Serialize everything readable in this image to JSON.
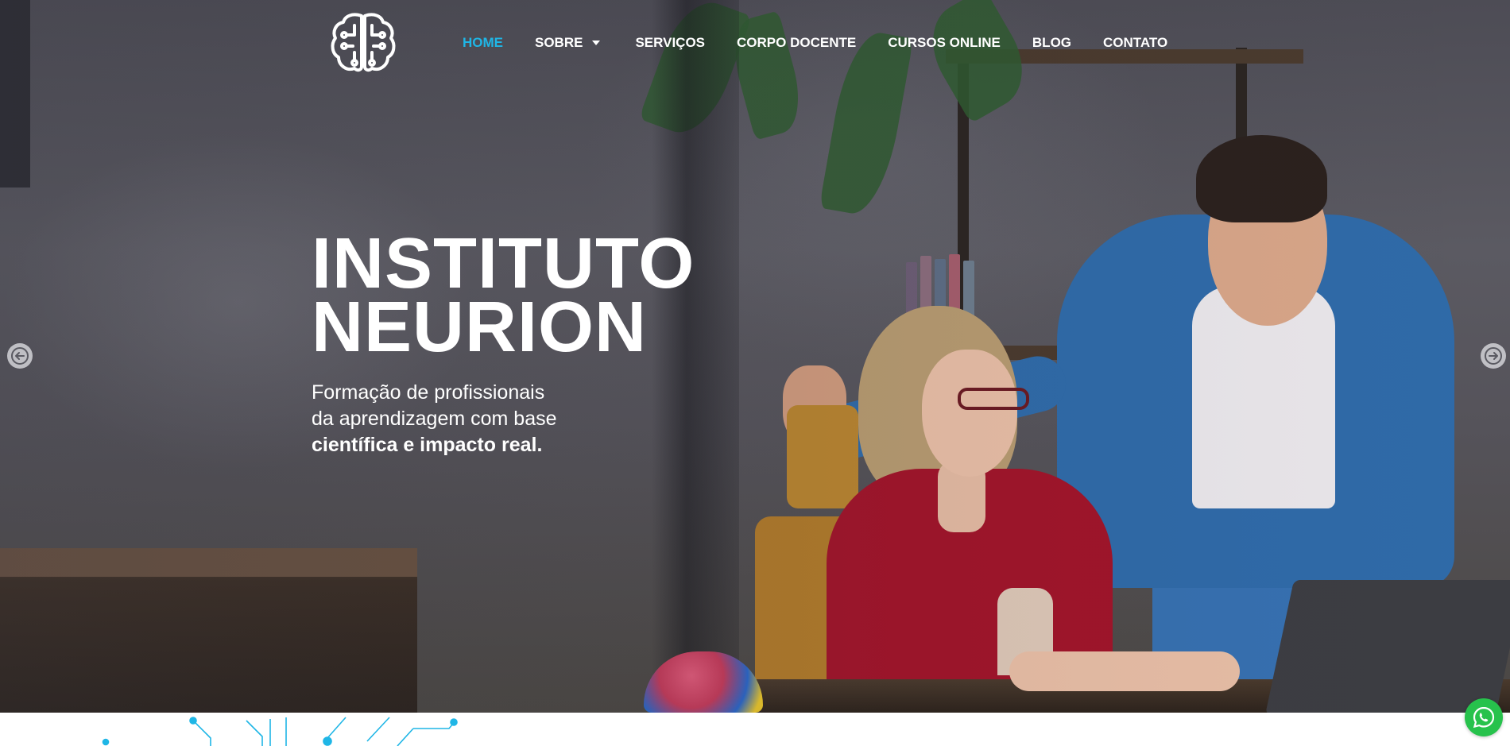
{
  "header": {
    "logo_icon": "brain-circuit-icon",
    "nav": {
      "home": "HOME",
      "sobre": "SOBRE",
      "servicos": "SERVIÇOS",
      "corpo_docente": "CORPO DOCENTE",
      "cursos_online": "CURSOS ONLINE",
      "blog": "BLOG",
      "contato": "CONTATO"
    },
    "active_item": "HOME",
    "active_color": "#1fb6e6"
  },
  "hero": {
    "title_line1": "INSTITUTO",
    "title_line2": "NEURION",
    "subtitle_line1": "Formação de profissionais",
    "subtitle_line2": "da aprendizagem com base",
    "subtitle_line3": "científica e impacto real."
  },
  "slider": {
    "prev_icon": "arrow-left-icon",
    "next_icon": "arrow-right-icon"
  },
  "floating": {
    "whatsapp_icon": "whatsapp-icon",
    "whatsapp_color": "#27c24c"
  },
  "decor": {
    "circuit_color": "#1fb6e6"
  }
}
